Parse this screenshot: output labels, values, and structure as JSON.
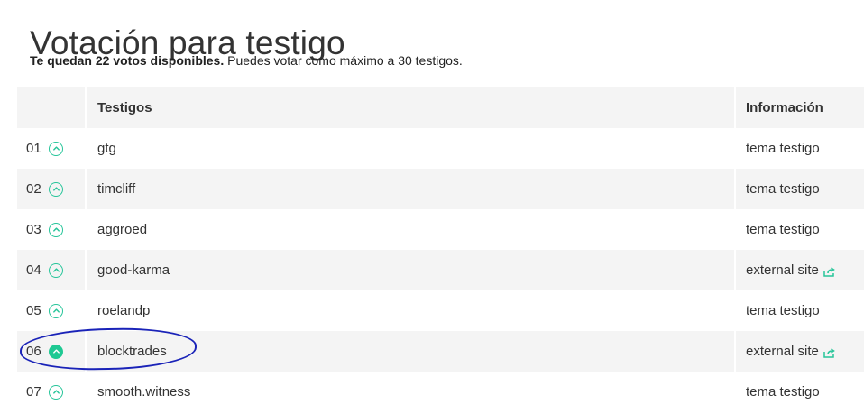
{
  "page": {
    "title": "Votación para testigo",
    "summary_bold": "Te quedan 22 votos disponibles.",
    "summary_rest": " Puedes votar como máximo a 30 testigos."
  },
  "table": {
    "headers": {
      "rank": "",
      "name": "Testigos",
      "info": "Información"
    },
    "rows": [
      {
        "rank": "01",
        "name": "gtg",
        "info": "tema testigo",
        "voted": false,
        "external": false
      },
      {
        "rank": "02",
        "name": "timcliff",
        "info": "tema testigo",
        "voted": false,
        "external": false
      },
      {
        "rank": "03",
        "name": "aggroed",
        "info": "tema testigo",
        "voted": false,
        "external": false
      },
      {
        "rank": "04",
        "name": "good-karma",
        "info": "external site",
        "voted": false,
        "external": true
      },
      {
        "rank": "05",
        "name": "roelandp",
        "info": "tema testigo",
        "voted": false,
        "external": false
      },
      {
        "rank": "06",
        "name": "blocktrades",
        "info": "external site",
        "voted": true,
        "external": true
      },
      {
        "rank": "07",
        "name": "smooth.witness",
        "info": "tema testigo",
        "voted": false,
        "external": false
      }
    ]
  },
  "colors": {
    "accent": "#1fc993",
    "annotation": "#1a23b8",
    "row_stripe": "#f4f4f4"
  },
  "icons": {
    "vote": "chevron-up-circle-icon",
    "external": "external-link-icon"
  }
}
